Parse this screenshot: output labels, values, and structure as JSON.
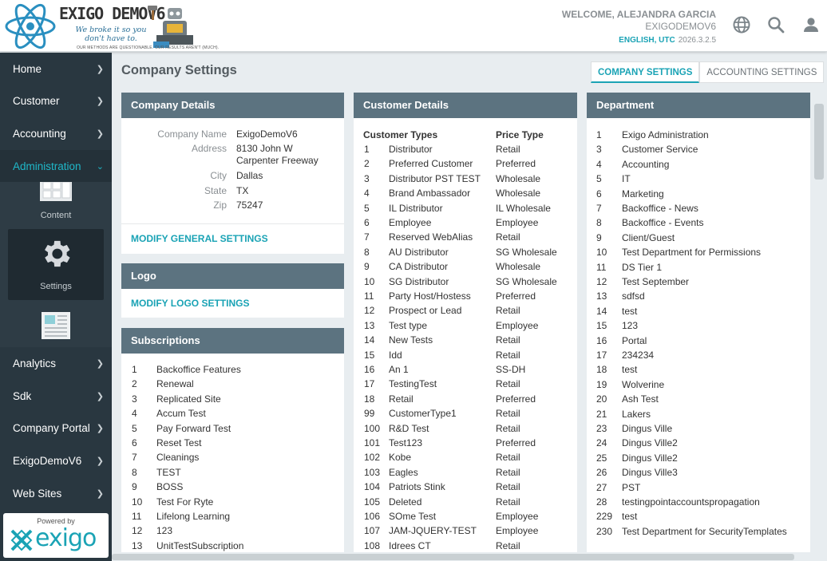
{
  "header": {
    "logo_text": "EXIGO DEMOV6",
    "logo_tagline": "We broke it so you don't have to.",
    "logo_subtext": "OUR METHODS ARE QUESTIONABLE. OUR RESULTS AREN'T (MUCH).",
    "welcome": "WELCOME, ALEJANDRA GARCIA",
    "company": "EXIGODEMOV6",
    "locale": "ENGLISH, UTC",
    "version": "2026.3.2.5",
    "icons": [
      "globe-icon",
      "search-icon",
      "user-icon"
    ]
  },
  "sidebar": {
    "items_top": [
      {
        "label": "Home"
      },
      {
        "label": "Customer"
      },
      {
        "label": "Accounting"
      },
      {
        "label": "Administration",
        "active": true
      }
    ],
    "sub_items": [
      {
        "label": "Content",
        "icon": "content-icon"
      },
      {
        "label": "Settings",
        "icon": "gear-icon",
        "selected": true
      },
      {
        "label": "",
        "icon": "newspaper-icon"
      }
    ],
    "items_bottom": [
      {
        "label": "Analytics"
      },
      {
        "label": "Sdk"
      },
      {
        "label": "Company Portal"
      },
      {
        "label": "ExigoDemoV6"
      },
      {
        "label": "Web Sites"
      }
    ],
    "powered_by": "Powered by",
    "brand": "exigo"
  },
  "main": {
    "title": "Company Settings",
    "tabs": [
      {
        "label": "COMPANY SETTINGS",
        "active": true
      },
      {
        "label": "ACCOUNTING SETTINGS",
        "active": false
      }
    ]
  },
  "company_details": {
    "title": "Company Details",
    "fields": {
      "company_name_label": "Company Name",
      "company_name": "ExigoDemoV6",
      "address_label": "Address",
      "address_line1": "8130 John W",
      "address_line2": "Carpenter Freeway",
      "city_label": "City",
      "city": "Dallas",
      "state_label": "State",
      "state": "TX",
      "zip_label": "Zip",
      "zip": "75247"
    },
    "link": "MODIFY GENERAL SETTINGS"
  },
  "logo_panel": {
    "title": "Logo",
    "link": "MODIFY LOGO SETTINGS"
  },
  "subscriptions": {
    "title": "Subscriptions",
    "items": [
      {
        "id": "1",
        "name": "Backoffice Features"
      },
      {
        "id": "2",
        "name": "Renewal"
      },
      {
        "id": "3",
        "name": "Replicated Site"
      },
      {
        "id": "4",
        "name": "Accum Test"
      },
      {
        "id": "5",
        "name": "Pay Forward Test"
      },
      {
        "id": "6",
        "name": "Reset Test"
      },
      {
        "id": "7",
        "name": "Cleanings"
      },
      {
        "id": "8",
        "name": "TEST"
      },
      {
        "id": "9",
        "name": "BOSS"
      },
      {
        "id": "10",
        "name": "Test For Ryte"
      },
      {
        "id": "11",
        "name": "Lifelong Learning"
      },
      {
        "id": "12",
        "name": "123"
      },
      {
        "id": "13",
        "name": "UnitTestSubscription"
      }
    ]
  },
  "customer_details": {
    "title": "Customer Details",
    "col_type": "Customer Types",
    "col_price": "Price Type",
    "rows": [
      {
        "id": "1",
        "type": "Distributor",
        "price": "Retail"
      },
      {
        "id": "2",
        "type": "Preferred Customer",
        "price": "Preferred"
      },
      {
        "id": "3",
        "type": "Distributor PST TEST",
        "price": "Wholesale"
      },
      {
        "id": "4",
        "type": "Brand Ambassador",
        "price": "Wholesale"
      },
      {
        "id": "5",
        "type": "IL Distributor",
        "price": "IL Wholesale"
      },
      {
        "id": "6",
        "type": "Employee",
        "price": "Employee"
      },
      {
        "id": "7",
        "type": "Reserved WebAlias",
        "price": "Retail"
      },
      {
        "id": "8",
        "type": "AU Distributor",
        "price": "SG Wholesale"
      },
      {
        "id": "9",
        "type": "CA Distributor",
        "price": "Wholesale"
      },
      {
        "id": "10",
        "type": "SG Distributor",
        "price": "SG Wholesale"
      },
      {
        "id": "11",
        "type": "Party Host/Hostess",
        "price": "Preferred"
      },
      {
        "id": "12",
        "type": "Prospect or Lead",
        "price": "Retail"
      },
      {
        "id": "13",
        "type": "Test type",
        "price": "Employee"
      },
      {
        "id": "14",
        "type": "New Tests",
        "price": "Retail"
      },
      {
        "id": "15",
        "type": "Idd",
        "price": "Retail"
      },
      {
        "id": "16",
        "type": "An 1",
        "price": "SS-DH"
      },
      {
        "id": "17",
        "type": "TestingTest",
        "price": "Retail"
      },
      {
        "id": "18",
        "type": "Retail",
        "price": "Preferred"
      },
      {
        "id": "99",
        "type": "CustomerType1",
        "price": "Retail"
      },
      {
        "id": "100",
        "type": "R&D Test",
        "price": "Retail"
      },
      {
        "id": "101",
        "type": "Test123",
        "price": "Preferred"
      },
      {
        "id": "102",
        "type": "Kobe",
        "price": "Retail"
      },
      {
        "id": "103",
        "type": "Eagles",
        "price": "Retail"
      },
      {
        "id": "104",
        "type": "Patriots Stink",
        "price": "Retail"
      },
      {
        "id": "105",
        "type": "Deleted",
        "price": "Retail"
      },
      {
        "id": "106",
        "type": "SOme Test",
        "price": "Employee"
      },
      {
        "id": "107",
        "type": "JAM-JQUERY-TEST",
        "price": "Employee"
      },
      {
        "id": "108",
        "type": "Idrees CT",
        "price": "Retail"
      }
    ]
  },
  "department": {
    "title": "Department",
    "rows": [
      {
        "id": "1",
        "name": "Exigo Administration"
      },
      {
        "id": "3",
        "name": "Customer Service"
      },
      {
        "id": "4",
        "name": "Accounting"
      },
      {
        "id": "5",
        "name": "IT"
      },
      {
        "id": "6",
        "name": "Marketing"
      },
      {
        "id": "7",
        "name": "Backoffice - News"
      },
      {
        "id": "8",
        "name": "Backoffice - Events"
      },
      {
        "id": "9",
        "name": "Client/Guest"
      },
      {
        "id": "10",
        "name": "Test Department for Permissions"
      },
      {
        "id": "11",
        "name": "DS Tier 1"
      },
      {
        "id": "12",
        "name": "Test September"
      },
      {
        "id": "13",
        "name": "sdfsd"
      },
      {
        "id": "14",
        "name": "test"
      },
      {
        "id": "15",
        "name": "123"
      },
      {
        "id": "16",
        "name": "Portal"
      },
      {
        "id": "17",
        "name": "234234"
      },
      {
        "id": "18",
        "name": "test"
      },
      {
        "id": "19",
        "name": "Wolverine"
      },
      {
        "id": "20",
        "name": "Ash Test"
      },
      {
        "id": "21",
        "name": "Lakers"
      },
      {
        "id": "23",
        "name": "Dingus Ville"
      },
      {
        "id": "24",
        "name": "Dingus Ville2"
      },
      {
        "id": "25",
        "name": "Dingus Ville2"
      },
      {
        "id": "26",
        "name": "Dingus Ville3"
      },
      {
        "id": "27",
        "name": "PST"
      },
      {
        "id": "28",
        "name": "testingpointaccountspropagation"
      },
      {
        "id": "229",
        "name": "test"
      },
      {
        "id": "230",
        "name": "Test Department for SecurityTemplates"
      }
    ]
  },
  "colors": {
    "accent": "#1aa3b5",
    "sidebar_bg": "#293740",
    "panel_header": "#5c7380",
    "page_bg": "#e8edf0"
  }
}
